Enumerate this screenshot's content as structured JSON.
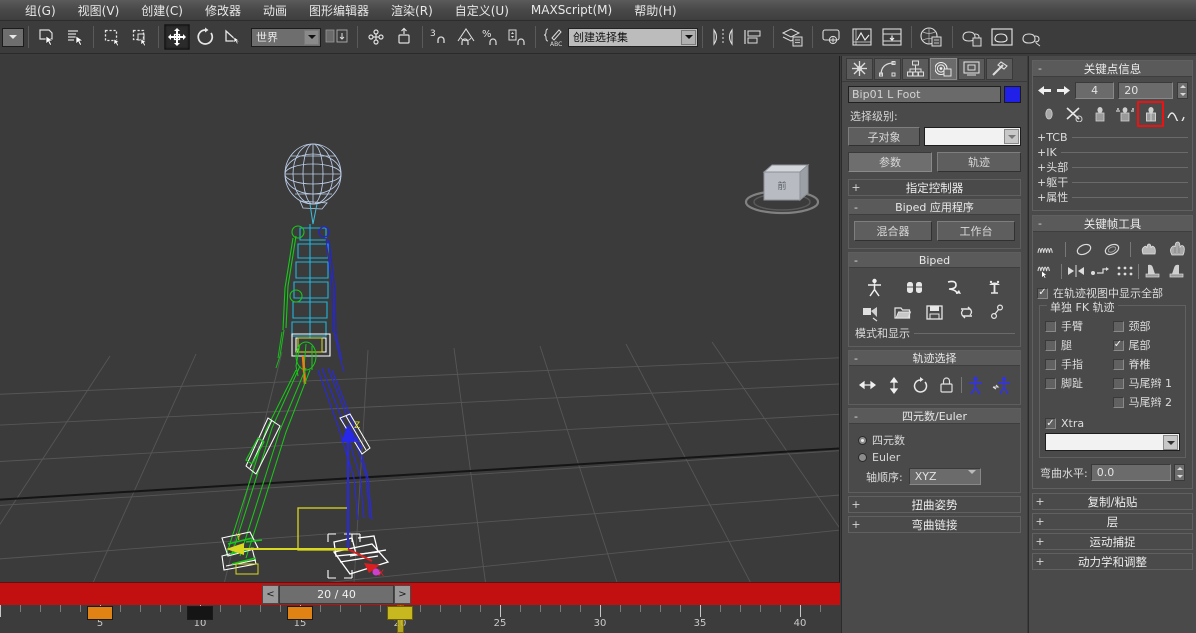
{
  "menu": {
    "items": [
      {
        "label": "组(G)",
        "name": "menu-group"
      },
      {
        "label": "视图(V)",
        "name": "menu-view"
      },
      {
        "label": "创建(C)",
        "name": "menu-create"
      },
      {
        "label": "修改器",
        "name": "menu-modifiers"
      },
      {
        "label": "动画",
        "name": "menu-animation"
      },
      {
        "label": "图形编辑器",
        "name": "menu-graph-editors"
      },
      {
        "label": "渲染(R)",
        "name": "menu-rendering"
      },
      {
        "label": "自定义(U)",
        "name": "menu-customize"
      },
      {
        "label": "MAXScript(M)",
        "name": "menu-maxscript"
      },
      {
        "label": "帮助(H)",
        "name": "menu-help"
      }
    ]
  },
  "toolbar": {
    "ref_coord_value": "世界",
    "selection_set_placeholder": "创建选择集",
    "selection_set_value": "创建选择集",
    "snap_percent_label": "%",
    "snap_angle_label": "3"
  },
  "viewport": {
    "label": "",
    "bg_color": "#3b3b3b",
    "grid_color": "#4f4f4f",
    "biped_head_color": "#c8d8f0",
    "biped_spine_color": "#18b4d8",
    "biped_left_color": "#18c818",
    "biped_right_color": "#2828e0",
    "selected_color": "#ffffff",
    "gizmo_y_color": "#d8d820",
    "gizmo_z_color": "#2020d8",
    "gizmo_x_color": "#d82020"
  },
  "trackbar": {
    "current_frame_display": "20 / 40",
    "prev_arrow": "<",
    "next_arrow": ">",
    "bar_color": "#c21010",
    "keys": [
      {
        "frame": 5,
        "state": "orange"
      },
      {
        "frame": 10,
        "state": "black"
      },
      {
        "frame": 15,
        "state": "orange"
      },
      {
        "frame": 20,
        "state": "current"
      }
    ],
    "ruler_labels": [
      "5",
      "10",
      "15",
      "20",
      "25",
      "30",
      "35",
      "40"
    ],
    "ruler_values": [
      5,
      10,
      15,
      20,
      25,
      30,
      35,
      40
    ],
    "ruler_min": 0,
    "ruler_max": 42
  },
  "command_panel": {
    "tabs": [
      {
        "name": "tab-create",
        "icon": "create-star-icon",
        "selected": false
      },
      {
        "name": "tab-modify",
        "icon": "modify-curve-icon",
        "selected": false
      },
      {
        "name": "tab-hierarchy",
        "icon": "hierarchy-icon",
        "selected": false
      },
      {
        "name": "tab-motion",
        "icon": "motion-wheel-icon",
        "selected": true
      },
      {
        "name": "tab-display",
        "icon": "display-monitor-icon",
        "selected": false
      },
      {
        "name": "tab-utilities",
        "icon": "utilities-hammer-icon",
        "selected": false
      }
    ],
    "object_name": "Bip01 L Foot",
    "object_color": "#2020e8",
    "sub_level_label": "选择级别:",
    "sub_object_button": "子对象",
    "sub_object_combo_value": "",
    "parameters_button": "参数",
    "trajectories_button": "轨迹",
    "rollups": {
      "assign_controller": {
        "title": "指定控制器",
        "state": "+"
      },
      "biped_apps": {
        "title": "Biped 应用程序",
        "state": "-",
        "mixer_button": "混合器",
        "workbench_button": "工作台"
      },
      "biped": {
        "title": "Biped",
        "state": "-",
        "row1": [
          "figure-mode-icon",
          "footstep-mode-icon",
          "motion-flow-mode-icon",
          "mixer-mode-icon"
        ],
        "row2": [
          "load-file-icon",
          "open-folder-icon",
          "save-file-icon",
          "convert-icon",
          "preferences-icon"
        ]
      },
      "modes_display": {
        "title": "模式和显示",
        "state": "+"
      },
      "track_selection": {
        "title": "轨迹选择",
        "state": "-",
        "icons": [
          "body-horizontal-icon",
          "body-vertical-icon",
          "body-rotation-icon",
          "lock-com-icon",
          "symmetrical-icon",
          "opposite-icon"
        ]
      },
      "quaternion_euler": {
        "title": "四元数/Euler",
        "state": "-",
        "option_quaternion": "四元数",
        "option_euler": "Euler",
        "selected_option": "四元数",
        "axis_order_label": "轴顺序:",
        "axis_order_value": "XYZ"
      },
      "twist_poses": {
        "title": "扭曲姿势",
        "state": "+"
      },
      "bend_links": {
        "title": "弯曲链接",
        "state": "+"
      }
    }
  },
  "motion_panel": {
    "key_info": {
      "title": "关键点信息",
      "state": "-",
      "prev_key_icon": "arrow-left-icon",
      "next_key_icon": "arrow-right-icon",
      "key_number": "4",
      "frame_value": "20",
      "icons": [
        {
          "name": "key-ellipse-icon",
          "highlighted": false
        },
        {
          "name": "delete-key-icon",
          "highlighted": false
        },
        {
          "name": "set-key-icon",
          "highlighted": false
        },
        {
          "name": "set-planted-key-icon",
          "highlighted": false
        },
        {
          "name": "set-sliding-key-icon",
          "highlighted": true
        },
        {
          "name": "curve-icon",
          "highlighted": false
        }
      ],
      "highlight_color": "#ee1111",
      "sections": [
        {
          "label": "+TCB",
          "name": "section-tcb"
        },
        {
          "label": "+IK",
          "name": "section-ik"
        },
        {
          "label": "+头部",
          "name": "section-head"
        },
        {
          "label": "+躯干",
          "name": "section-torso"
        },
        {
          "label": "+属性",
          "name": "section-properties"
        }
      ]
    },
    "keyframe_tools": {
      "title": "关键帧工具",
      "state": "-",
      "row1": [
        "wave-icon",
        "divider",
        "ellipse-tool-icon",
        "ellipse-tool2-icon",
        "divider",
        "hand-pose-icon",
        "hand-pose2-icon"
      ],
      "row2": [
        "wave-select-icon",
        "divider",
        "mirror-icon",
        "align-icon",
        "dots-icon",
        "divider",
        "footstep-icon",
        "footstep2-icon"
      ],
      "show_all_in_trackview": {
        "label": "在轨迹视图中显示全部",
        "checked": true
      },
      "separate_fk_tracks": {
        "title": "单独 FK 轨迹",
        "left_column": [
          {
            "label": "手臂",
            "checked": false,
            "name": "cb-arms"
          },
          {
            "label": "腿",
            "checked": false,
            "name": "cb-legs"
          },
          {
            "label": "手指",
            "checked": false,
            "name": "cb-fingers"
          },
          {
            "label": "脚趾",
            "checked": false,
            "name": "cb-toes"
          }
        ],
        "right_column": [
          {
            "label": "颈部",
            "checked": false,
            "name": "cb-neck"
          },
          {
            "label": "尾部",
            "checked": true,
            "name": "cb-tail"
          },
          {
            "label": "脊椎",
            "checked": false,
            "name": "cb-spine"
          },
          {
            "label": "马尾辫 1",
            "checked": false,
            "name": "cb-ponytail1"
          },
          {
            "label": "马尾辫 2",
            "checked": false,
            "name": "cb-ponytail2"
          }
        ],
        "xtra": {
          "label": "Xtra",
          "checked": true
        },
        "xtra_combo_value": ""
      },
      "bend_level": {
        "label": "弯曲水平:",
        "value": "0.0"
      }
    },
    "collapsed_rollups": [
      {
        "label": "复制/粘贴",
        "state": "+",
        "name": "rollup-copy-paste"
      },
      {
        "label": "层",
        "state": "+",
        "name": "rollup-layers"
      },
      {
        "label": "运动捕捉",
        "state": "+",
        "name": "rollup-motion-capture"
      },
      {
        "label": "动力学和调整",
        "state": "+",
        "name": "rollup-dynamics-adaptation"
      }
    ]
  }
}
